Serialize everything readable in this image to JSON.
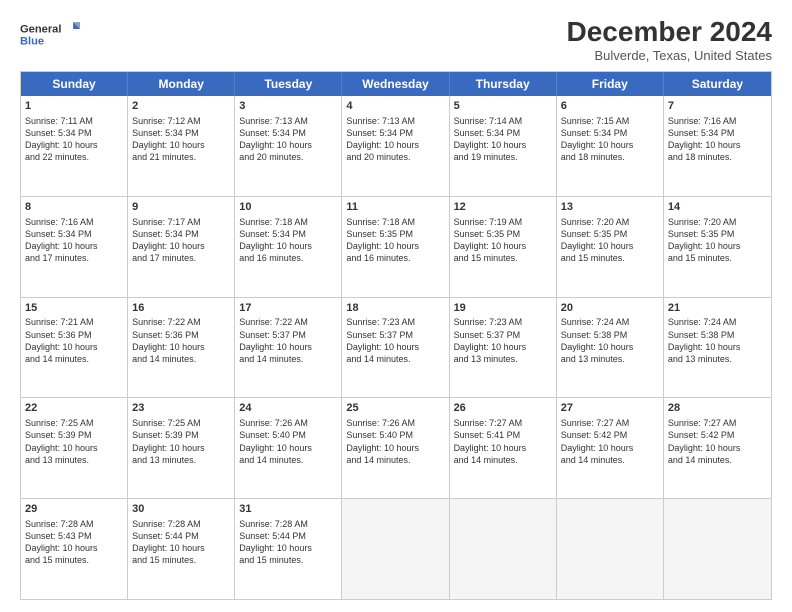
{
  "logo": {
    "line1": "General",
    "line2": "Blue"
  },
  "title": "December 2024",
  "location": "Bulverde, Texas, United States",
  "header_days": [
    "Sunday",
    "Monday",
    "Tuesday",
    "Wednesday",
    "Thursday",
    "Friday",
    "Saturday"
  ],
  "rows": [
    [
      {
        "day": "1",
        "info": "Sunrise: 7:11 AM\nSunset: 5:34 PM\nDaylight: 10 hours\nand 22 minutes."
      },
      {
        "day": "2",
        "info": "Sunrise: 7:12 AM\nSunset: 5:34 PM\nDaylight: 10 hours\nand 21 minutes."
      },
      {
        "day": "3",
        "info": "Sunrise: 7:13 AM\nSunset: 5:34 PM\nDaylight: 10 hours\nand 20 minutes."
      },
      {
        "day": "4",
        "info": "Sunrise: 7:13 AM\nSunset: 5:34 PM\nDaylight: 10 hours\nand 20 minutes."
      },
      {
        "day": "5",
        "info": "Sunrise: 7:14 AM\nSunset: 5:34 PM\nDaylight: 10 hours\nand 19 minutes."
      },
      {
        "day": "6",
        "info": "Sunrise: 7:15 AM\nSunset: 5:34 PM\nDaylight: 10 hours\nand 18 minutes."
      },
      {
        "day": "7",
        "info": "Sunrise: 7:16 AM\nSunset: 5:34 PM\nDaylight: 10 hours\nand 18 minutes."
      }
    ],
    [
      {
        "day": "8",
        "info": "Sunrise: 7:16 AM\nSunset: 5:34 PM\nDaylight: 10 hours\nand 17 minutes."
      },
      {
        "day": "9",
        "info": "Sunrise: 7:17 AM\nSunset: 5:34 PM\nDaylight: 10 hours\nand 17 minutes."
      },
      {
        "day": "10",
        "info": "Sunrise: 7:18 AM\nSunset: 5:34 PM\nDaylight: 10 hours\nand 16 minutes."
      },
      {
        "day": "11",
        "info": "Sunrise: 7:18 AM\nSunset: 5:35 PM\nDaylight: 10 hours\nand 16 minutes."
      },
      {
        "day": "12",
        "info": "Sunrise: 7:19 AM\nSunset: 5:35 PM\nDaylight: 10 hours\nand 15 minutes."
      },
      {
        "day": "13",
        "info": "Sunrise: 7:20 AM\nSunset: 5:35 PM\nDaylight: 10 hours\nand 15 minutes."
      },
      {
        "day": "14",
        "info": "Sunrise: 7:20 AM\nSunset: 5:35 PM\nDaylight: 10 hours\nand 15 minutes."
      }
    ],
    [
      {
        "day": "15",
        "info": "Sunrise: 7:21 AM\nSunset: 5:36 PM\nDaylight: 10 hours\nand 14 minutes."
      },
      {
        "day": "16",
        "info": "Sunrise: 7:22 AM\nSunset: 5:36 PM\nDaylight: 10 hours\nand 14 minutes."
      },
      {
        "day": "17",
        "info": "Sunrise: 7:22 AM\nSunset: 5:37 PM\nDaylight: 10 hours\nand 14 minutes."
      },
      {
        "day": "18",
        "info": "Sunrise: 7:23 AM\nSunset: 5:37 PM\nDaylight: 10 hours\nand 14 minutes."
      },
      {
        "day": "19",
        "info": "Sunrise: 7:23 AM\nSunset: 5:37 PM\nDaylight: 10 hours\nand 13 minutes."
      },
      {
        "day": "20",
        "info": "Sunrise: 7:24 AM\nSunset: 5:38 PM\nDaylight: 10 hours\nand 13 minutes."
      },
      {
        "day": "21",
        "info": "Sunrise: 7:24 AM\nSunset: 5:38 PM\nDaylight: 10 hours\nand 13 minutes."
      }
    ],
    [
      {
        "day": "22",
        "info": "Sunrise: 7:25 AM\nSunset: 5:39 PM\nDaylight: 10 hours\nand 13 minutes."
      },
      {
        "day": "23",
        "info": "Sunrise: 7:25 AM\nSunset: 5:39 PM\nDaylight: 10 hours\nand 13 minutes."
      },
      {
        "day": "24",
        "info": "Sunrise: 7:26 AM\nSunset: 5:40 PM\nDaylight: 10 hours\nand 14 minutes."
      },
      {
        "day": "25",
        "info": "Sunrise: 7:26 AM\nSunset: 5:40 PM\nDaylight: 10 hours\nand 14 minutes."
      },
      {
        "day": "26",
        "info": "Sunrise: 7:27 AM\nSunset: 5:41 PM\nDaylight: 10 hours\nand 14 minutes."
      },
      {
        "day": "27",
        "info": "Sunrise: 7:27 AM\nSunset: 5:42 PM\nDaylight: 10 hours\nand 14 minutes."
      },
      {
        "day": "28",
        "info": "Sunrise: 7:27 AM\nSunset: 5:42 PM\nDaylight: 10 hours\nand 14 minutes."
      }
    ],
    [
      {
        "day": "29",
        "info": "Sunrise: 7:28 AM\nSunset: 5:43 PM\nDaylight: 10 hours\nand 15 minutes."
      },
      {
        "day": "30",
        "info": "Sunrise: 7:28 AM\nSunset: 5:44 PM\nDaylight: 10 hours\nand 15 minutes."
      },
      {
        "day": "31",
        "info": "Sunrise: 7:28 AM\nSunset: 5:44 PM\nDaylight: 10 hours\nand 15 minutes."
      },
      {
        "day": "",
        "info": ""
      },
      {
        "day": "",
        "info": ""
      },
      {
        "day": "",
        "info": ""
      },
      {
        "day": "",
        "info": ""
      }
    ]
  ]
}
